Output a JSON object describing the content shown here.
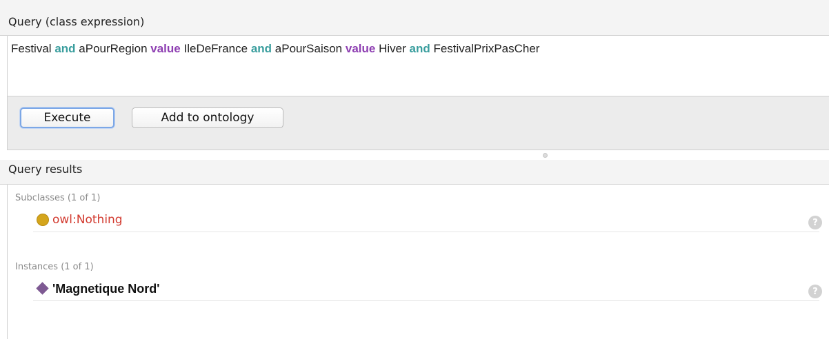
{
  "query_panel": {
    "title": "Query (class expression)",
    "expression": {
      "t1": "Festival",
      "k1": "and",
      "t2": "aPourRegion",
      "k2": "value",
      "t3": "IleDeFrance",
      "k3": "and",
      "t4": "aPourSaison",
      "k4": "value",
      "t5": "Hiver",
      "k5": "and",
      "t6": "FestivalPrixPasCher"
    },
    "execute_label": "Execute",
    "add_label": "Add to ontology"
  },
  "results_panel": {
    "title": "Query results",
    "subclasses": {
      "label": "Subclasses (1 of 1)",
      "items": [
        {
          "label": "owl:Nothing",
          "icon": "class-icon",
          "help": "?"
        }
      ]
    },
    "instances": {
      "label": "Instances (1 of 1)",
      "items": [
        {
          "label": "'Magnetique Nord'",
          "icon": "individual-icon",
          "help": "?"
        }
      ]
    }
  },
  "colors": {
    "keyword_and": "#3a9e9e",
    "keyword_value": "#8e3fb2",
    "nothing_text": "#d2392e",
    "class_icon": "#d4a51c",
    "individual_icon": "#7e5a93"
  }
}
